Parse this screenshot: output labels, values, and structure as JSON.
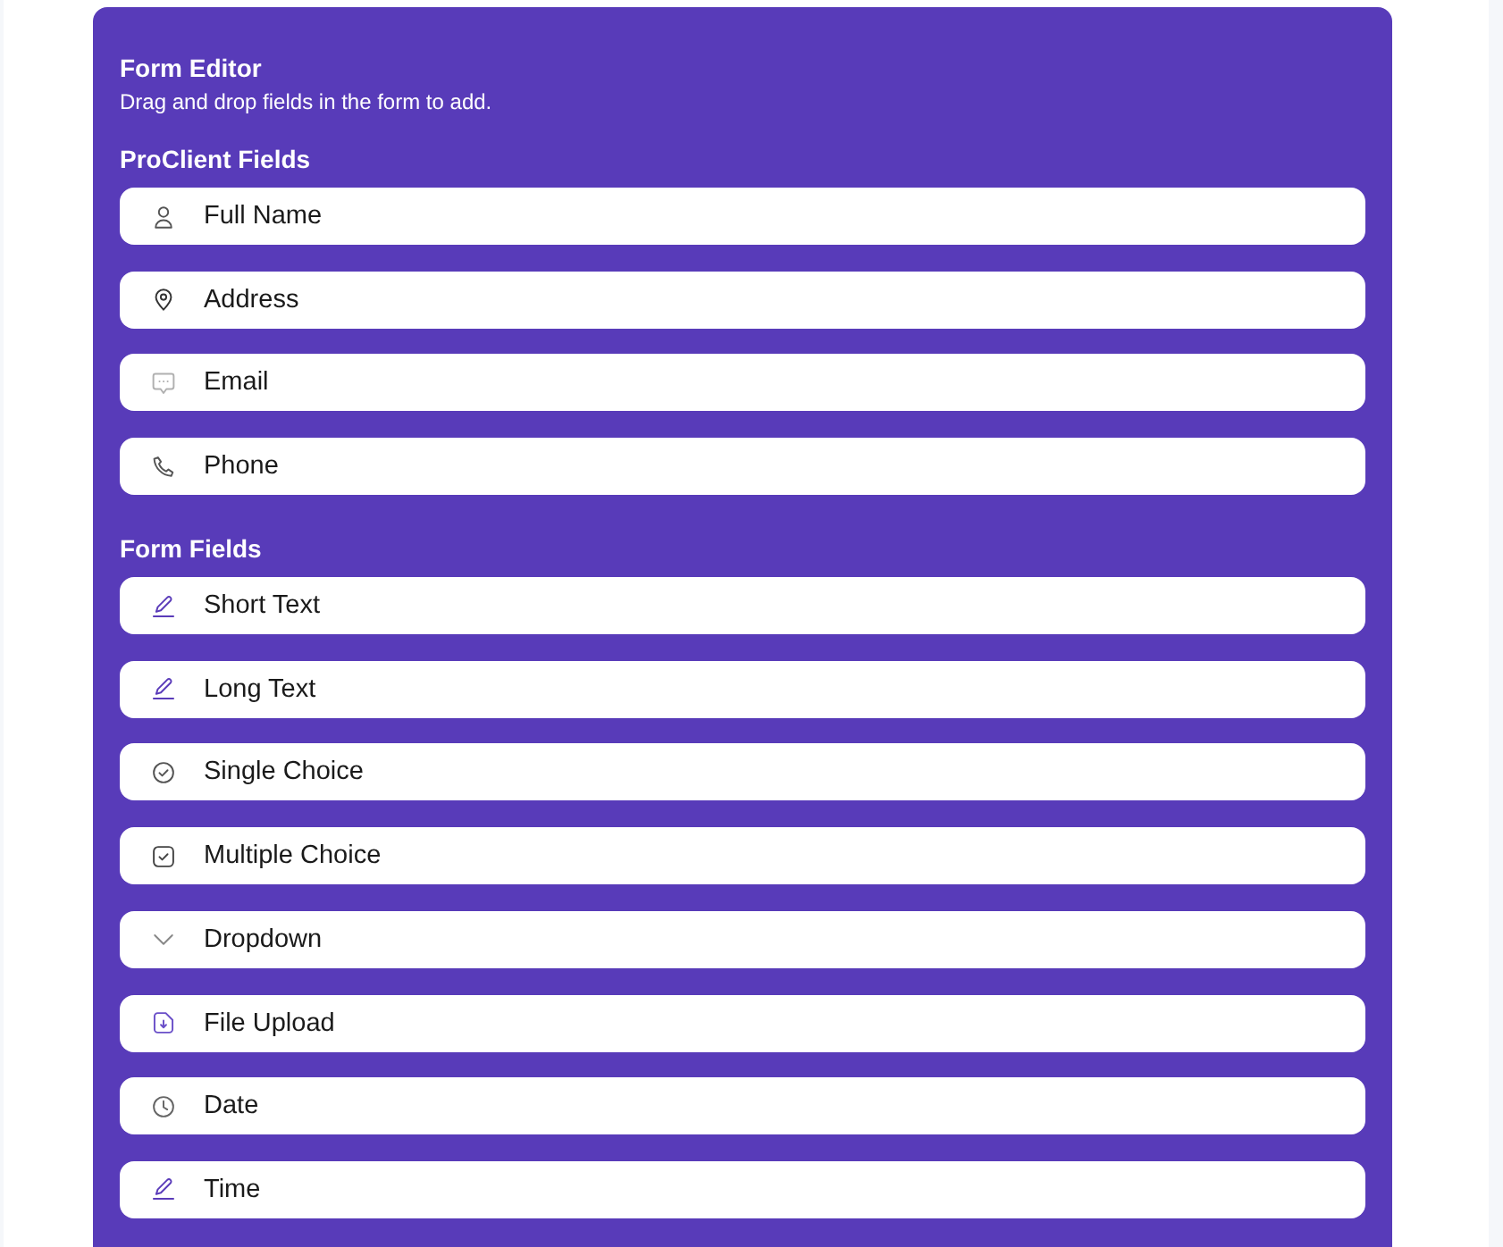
{
  "editor": {
    "title": "Form Editor",
    "subtitle": "Drag and drop fields in the form to add."
  },
  "sections": [
    {
      "heading": "ProClient Fields",
      "fields": [
        {
          "kind": "person",
          "label": "Full Name"
        },
        {
          "kind": "location",
          "label": "Address"
        },
        {
          "kind": "message",
          "label": "Email"
        },
        {
          "kind": "phone",
          "label": "Phone"
        }
      ]
    },
    {
      "heading": "Form Fields",
      "fields": [
        {
          "kind": "pencil",
          "label": "Short Text"
        },
        {
          "kind": "pencil",
          "label": "Long Text"
        },
        {
          "kind": "radio",
          "label": "Single Choice"
        },
        {
          "kind": "checkbox",
          "label": "Multiple Choice"
        },
        {
          "kind": "chevron",
          "label": "Dropdown"
        },
        {
          "kind": "file",
          "label": "File Upload"
        },
        {
          "kind": "clock",
          "label": "Date"
        },
        {
          "kind": "pencil",
          "label": "Time"
        }
      ]
    }
  ]
}
